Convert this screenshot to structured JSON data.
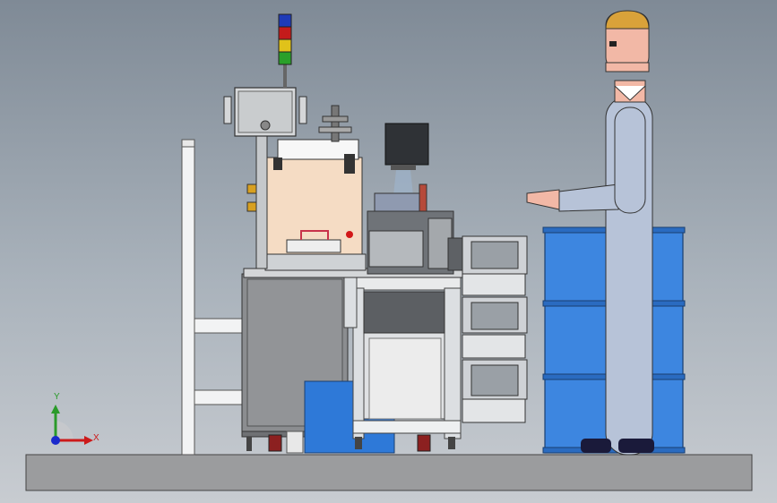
{
  "viewport": {
    "background_top": "#7f8a96",
    "background_bottom": "#c8ccd1"
  },
  "triad": {
    "x_label": "X",
    "y_label": "Y",
    "x_color": "#cc1a1a",
    "y_color": "#2a9a2a",
    "z_color": "#1a2acc"
  },
  "colors": {
    "floor": "#9a9a9a",
    "frame_steel": "#e6e8ea",
    "cabinet": "#8a8c8f",
    "enclosure": "#f5dcc4",
    "barrel": "#3d86e0",
    "mannequin_body": "#b7c3d8",
    "mannequin_head": "#f2b8a6",
    "hair": "#d9a23a",
    "signal_tower": [
      "#1f3bb8",
      "#c41b1b",
      "#e0c21a",
      "#2aa02a"
    ]
  }
}
